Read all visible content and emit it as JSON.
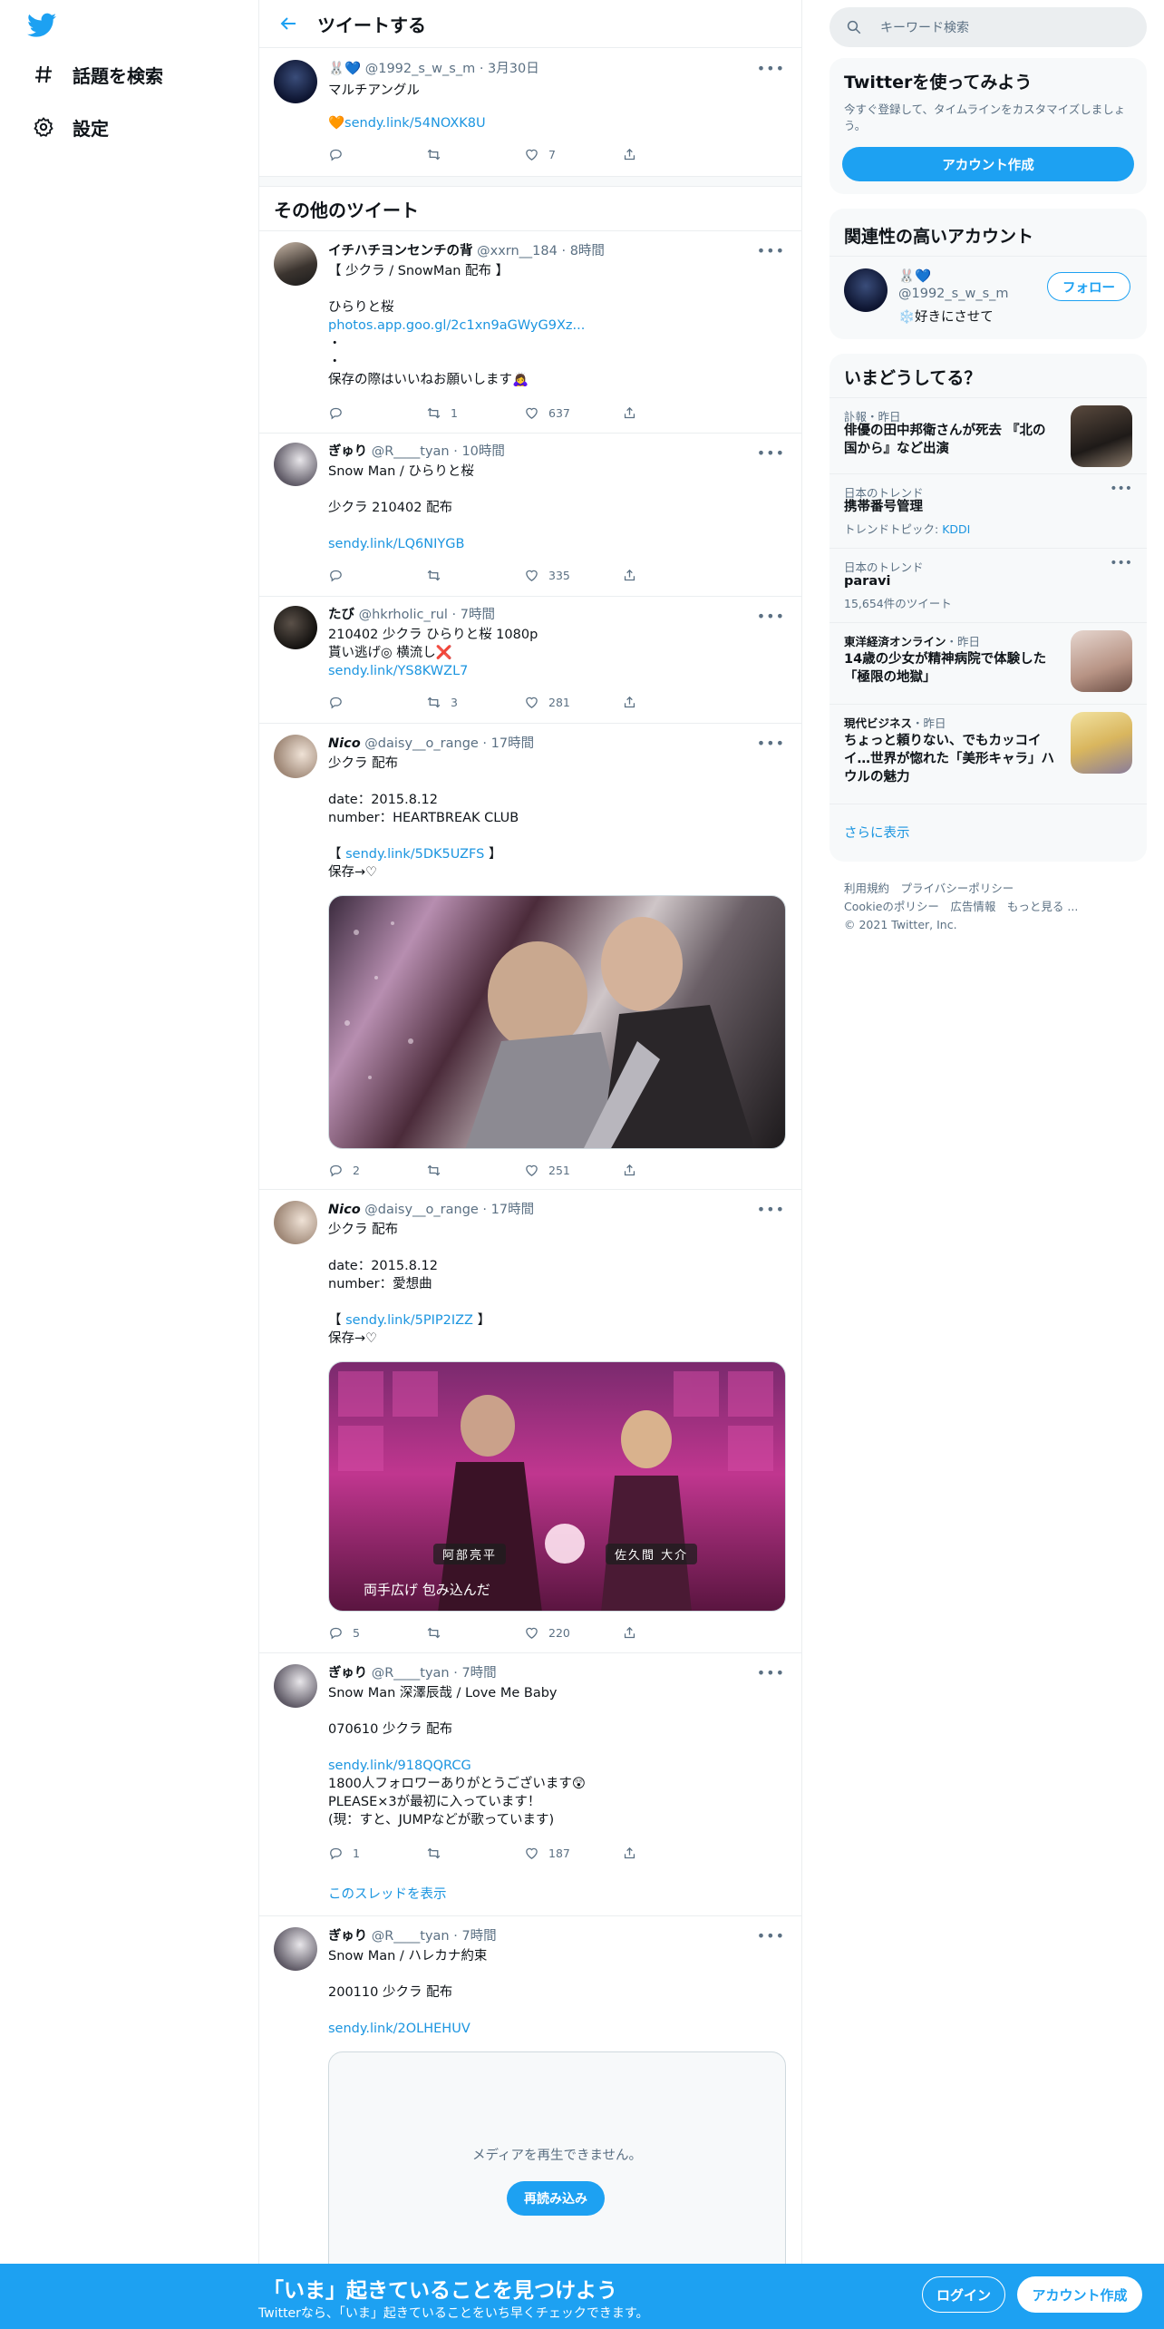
{
  "nav": {
    "explore_label": "話題を検索",
    "settings_label": "設定"
  },
  "header": {
    "title": "ツイートする"
  },
  "main_tweet": {
    "name": "🐰💙",
    "handle": "@1992_s_w_s_m",
    "date": "3月30日",
    "text": "マルチアングル",
    "link": "🧡sendy.link/54NOXK8U",
    "likes": "7"
  },
  "other_tweets_title": "その他のツイート",
  "tweets": [
    {
      "name": "イチハチヨンセンチの背",
      "handle": "@xxrn__184",
      "time": "8時間",
      "text": "【 少クラ / SnowMan 配布 】\n\nひらりと桜",
      "link": "photos.app.goo.gl/2c1xn9aGWyG9Xz...",
      "text2": "・\n・\n保存の際はいいねお願いします🙇‍♀️",
      "retweets": "1",
      "likes": "637"
    },
    {
      "name": "ぎゅり",
      "handle": "@R____tyan",
      "time": "10時間",
      "text": "Snow Man / ひらりと桜\n\n少クラ 210402 配布",
      "link": "sendy.link/LQ6NIYGB",
      "likes": "335"
    },
    {
      "name": "たび",
      "handle": "@hkrholic_rul",
      "time": "7時間",
      "text": "210402 少クラ ひらりと桜 1080p\n貰い逃げ◎ 横流し❌",
      "link": "sendy.link/YS8KWZL7",
      "retweets": "3",
      "likes": "281"
    },
    {
      "name": "Nico",
      "handle": "@daisy__o_range",
      "time": "17時間",
      "text": "少クラ 配布",
      "date_line": "date：2015.8.12",
      "number_line": "number：HEARTBREAK CLUB",
      "bracket_open": "【 ",
      "link": "sendy.link/5DK5UZFS",
      "bracket_close": " 】",
      "save": "保存→♡",
      "replies": "2",
      "likes": "251"
    },
    {
      "name": "Nico",
      "handle": "@daisy__o_range",
      "time": "17時間",
      "text": "少クラ 配布",
      "date_line": "date：2015.8.12",
      "number_line": "number：愛想曲",
      "bracket_open": "【 ",
      "link": "sendy.link/5PIP2IZZ",
      "bracket_close": " 】",
      "save": "保存→♡",
      "caption_left": "阿部亮平",
      "caption_right": "佐久間 大介",
      "subtitle": "両手広げ 包み込んだ",
      "replies": "5",
      "likes": "220"
    },
    {
      "name": "ぎゅり",
      "handle": "@R____tyan",
      "time": "7時間",
      "text": "Snow Man 深澤辰哉 / Love Me Baby\n\n070610 少クラ 配布",
      "link": "sendy.link/918QQRCG",
      "text2": "1800人フォロワーありがとうございます😲\nPLEASE×3が最初に入っています！\n(現：すと、JUMPなどが歌っています)",
      "replies": "1",
      "likes": "187",
      "thread_link": "このスレッドを表示"
    },
    {
      "name": "ぎゅり",
      "handle": "@R____tyan",
      "time": "7時間",
      "text": "Snow Man / ハレカナ約束\n\n200110 少クラ 配布",
      "link": "sendy.link/2OLHEHUV",
      "media_error": "メディアを再生できません。",
      "reload": "再読み込み"
    }
  ],
  "sidebar": {
    "search_placeholder": "キーワード検索",
    "signup_card": {
      "title": "Twitterを使ってみよう",
      "desc": "今すぐ登録して、タイムラインをカスタマイズしましょう。",
      "button": "アカウント作成"
    },
    "related": {
      "title": "関連性の高いアカウント",
      "name": "🐰💙",
      "handle": "@1992_s_w_s_m",
      "bio": "❄️好きにさせて",
      "follow": "フォロー"
    },
    "trends": {
      "title": "いまどうしてる？",
      "items": [
        {
          "meta": "訃報・昨日",
          "title": "俳優の田中邦衛さんが死去 『北の国から』など出演"
        },
        {
          "meta": "日本のトレンド",
          "title": "携帯番号管理",
          "sub_prefix": "トレンドトピック: ",
          "sub_link": "KDDI"
        },
        {
          "meta": "日本のトレンド",
          "title": "paravi",
          "sub": "15,654件のツイート"
        },
        {
          "source": "東洋経済オンライン",
          "meta": "・昨日",
          "title": "14歳の少女が精神病院で体験した「極限の地獄」"
        },
        {
          "source": "現代ビジネス",
          "meta": "・昨日",
          "title": "ちょっと頼りない、でもカッコイイ…世界が惚れた「美形キャラ」ハウルの魅力"
        }
      ],
      "more": "さらに表示"
    },
    "footer": {
      "line1": "利用規約　プライバシーポリシー",
      "line2": "Cookieのポリシー　広告情報　もっと見る ...",
      "line3": "© 2021 Twitter, Inc."
    }
  },
  "banner": {
    "headline": "「いま」起きていることを見つけよう",
    "sub": "Twitterなら、「いま」起きていることをいち早くチェックできます。",
    "login": "ログイン",
    "signup": "アカウント作成"
  },
  "colors": {
    "accent": "#1da1f2",
    "link": "#1b95e0",
    "muted": "#5b7083",
    "border": "#ebeef0"
  }
}
